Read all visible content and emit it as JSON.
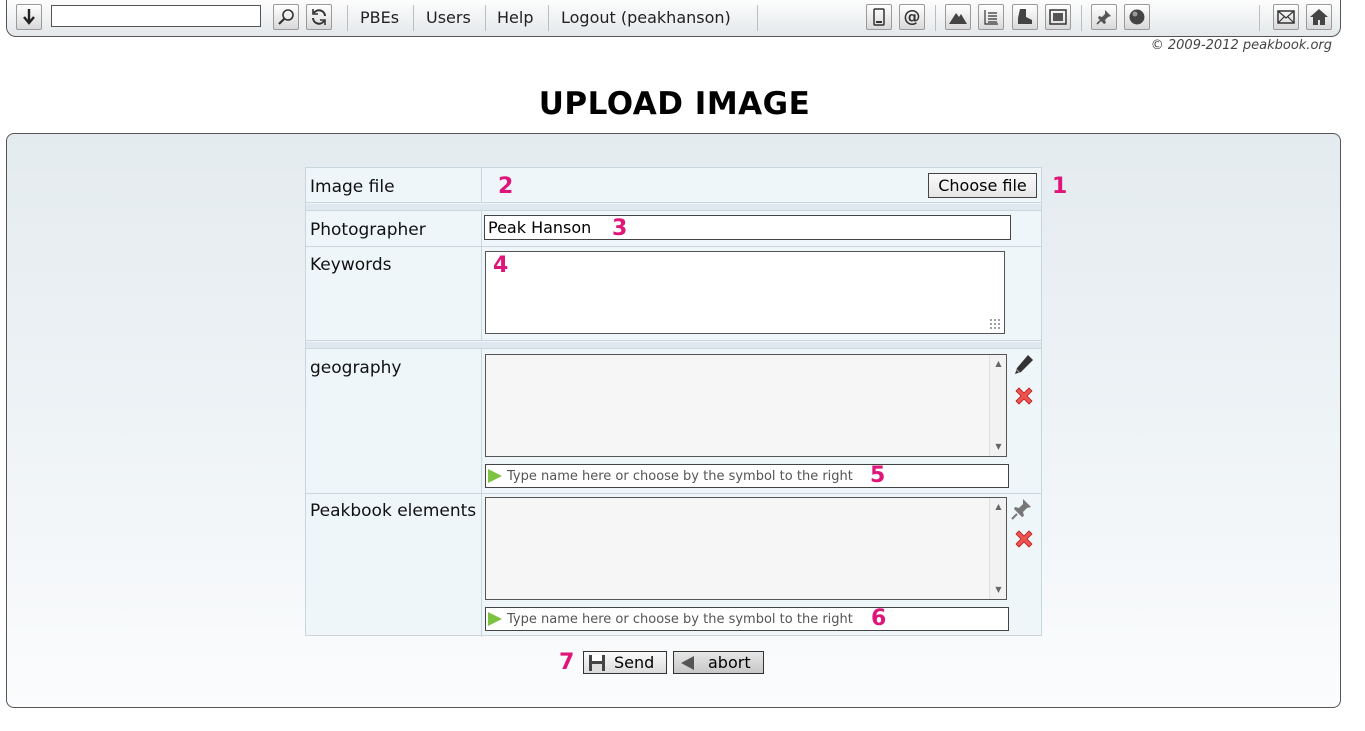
{
  "toolbar": {
    "search_placeholder": "",
    "links": [
      "PBEs",
      "Users",
      "Help",
      "Logout (peakhanson)"
    ],
    "icons_left": [
      "down-arrow-icon",
      "magnifier-icon",
      "refresh-icon"
    ],
    "icons_right": [
      "phone-icon",
      "at-sign-icon",
      "mountain-icon",
      "list-icon",
      "boot-icon",
      "picture-icon",
      "pin-icon",
      "globe-icon",
      "mail-icon",
      "home-icon"
    ]
  },
  "copyright": "© 2009-2012 peakbook.org",
  "page_title": "UPLOAD IMAGE",
  "form": {
    "image_file_label": "Image file",
    "choose_file_button": "Choose file",
    "photographer_label": "Photographer",
    "photographer_value": "Peak Hanson",
    "keywords_label": "Keywords",
    "keywords_value": "",
    "geography_label": "geography",
    "geography_hint": "Type name here or choose by the symbol to the right",
    "elements_label": "Peakbook elements",
    "elements_hint": "Type name here or choose by the symbol to the right"
  },
  "actions": {
    "send_label": "Send",
    "abort_label": "abort"
  },
  "markers": [
    "1",
    "2",
    "3",
    "4",
    "5",
    "6",
    "7"
  ],
  "colors": {
    "marker": "#e0157a",
    "panel_bg": "#e9eff3",
    "play_arrow": "#7dc243",
    "delete_red": "#e53935"
  }
}
